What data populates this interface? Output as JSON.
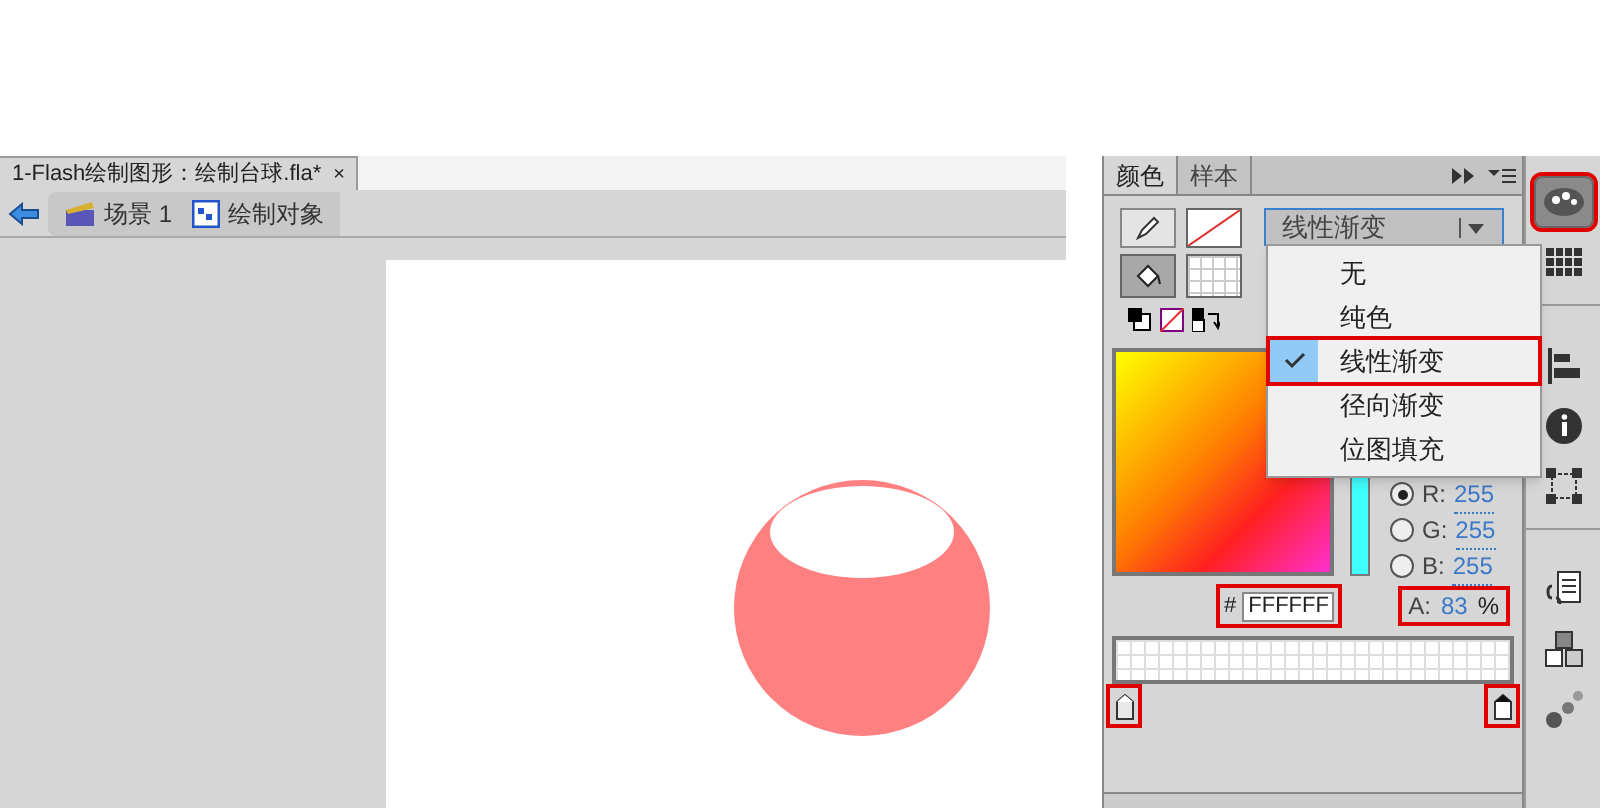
{
  "document": {
    "tab": {
      "title": "1-Flash绘制图形：绘制台球.fla*",
      "close": "×"
    },
    "breadcrumbs": [
      {
        "label": "场景 1",
        "kind": "scene"
      },
      {
        "label": "绘制对象",
        "kind": "object"
      }
    ]
  },
  "color_panel": {
    "tabs": [
      {
        "label": "颜色",
        "selected": true
      },
      {
        "label": "样本",
        "selected": false
      }
    ],
    "fill_type": {
      "value": "线性渐变",
      "expanded": true
    },
    "menu": [
      {
        "label": "无",
        "selected": false,
        "annotated": false
      },
      {
        "label": "纯色",
        "selected": false,
        "annotated": false
      },
      {
        "label": "线性渐变",
        "selected": true,
        "annotated": true
      },
      {
        "label": "径向渐变",
        "selected": false,
        "annotated": false
      },
      {
        "label": "位图填充",
        "selected": false,
        "annotated": false
      }
    ],
    "channels": [
      {
        "label": "R:",
        "value": "255",
        "selected": true
      },
      {
        "label": "G:",
        "value": "255",
        "selected": false
      },
      {
        "label": "B:",
        "value": "255",
        "selected": false
      }
    ],
    "hex": {
      "prefix": "#",
      "value": "FFFFFF",
      "annotated": true
    },
    "alpha": {
      "label": "A:",
      "value": "83",
      "unit": "%",
      "annotated": true
    },
    "stops": [
      {
        "selected": false,
        "annotated": true
      },
      {
        "selected": true,
        "annotated": true
      }
    ]
  },
  "dock": [
    {
      "kind": "palette",
      "selected": true,
      "annotated": true
    },
    {
      "kind": "swatches",
      "selected": false,
      "annotated": false
    },
    {
      "kind": "sep"
    },
    {
      "kind": "align",
      "selected": false,
      "annotated": false
    },
    {
      "kind": "info",
      "selected": false,
      "annotated": false
    },
    {
      "kind": "transform",
      "selected": false,
      "annotated": false
    },
    {
      "kind": "sep"
    },
    {
      "kind": "code",
      "selected": false,
      "annotated": false
    },
    {
      "kind": "components",
      "selected": false,
      "annotated": false
    },
    {
      "kind": "motion",
      "selected": false,
      "annotated": false
    }
  ]
}
